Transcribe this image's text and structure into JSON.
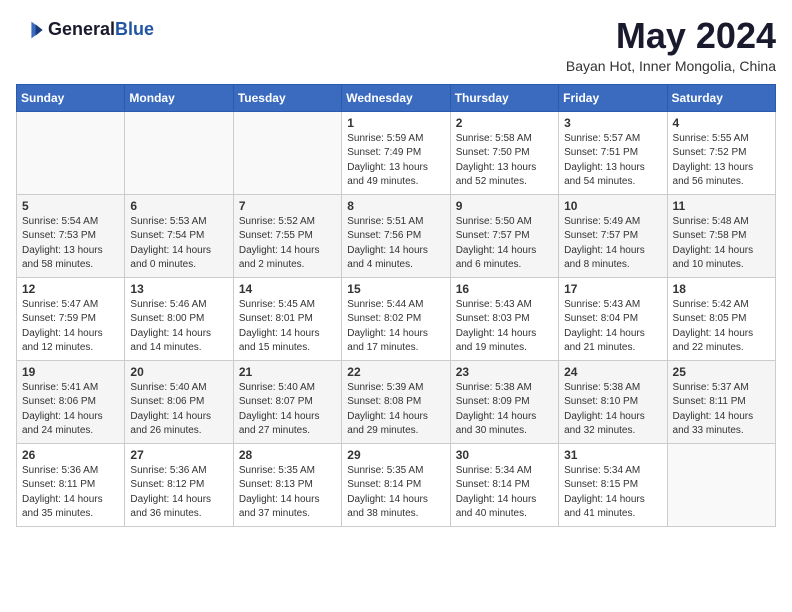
{
  "header": {
    "logo_general": "General",
    "logo_blue": "Blue",
    "title": "May 2024",
    "subtitle": "Bayan Hot, Inner Mongolia, China"
  },
  "days_of_week": [
    "Sunday",
    "Monday",
    "Tuesday",
    "Wednesday",
    "Thursday",
    "Friday",
    "Saturday"
  ],
  "weeks": [
    [
      {
        "day": "",
        "info": ""
      },
      {
        "day": "",
        "info": ""
      },
      {
        "day": "",
        "info": ""
      },
      {
        "day": "1",
        "info": "Sunrise: 5:59 AM\nSunset: 7:49 PM\nDaylight: 13 hours and 49 minutes."
      },
      {
        "day": "2",
        "info": "Sunrise: 5:58 AM\nSunset: 7:50 PM\nDaylight: 13 hours and 52 minutes."
      },
      {
        "day": "3",
        "info": "Sunrise: 5:57 AM\nSunset: 7:51 PM\nDaylight: 13 hours and 54 minutes."
      },
      {
        "day": "4",
        "info": "Sunrise: 5:55 AM\nSunset: 7:52 PM\nDaylight: 13 hours and 56 minutes."
      }
    ],
    [
      {
        "day": "5",
        "info": "Sunrise: 5:54 AM\nSunset: 7:53 PM\nDaylight: 13 hours and 58 minutes."
      },
      {
        "day": "6",
        "info": "Sunrise: 5:53 AM\nSunset: 7:54 PM\nDaylight: 14 hours and 0 minutes."
      },
      {
        "day": "7",
        "info": "Sunrise: 5:52 AM\nSunset: 7:55 PM\nDaylight: 14 hours and 2 minutes."
      },
      {
        "day": "8",
        "info": "Sunrise: 5:51 AM\nSunset: 7:56 PM\nDaylight: 14 hours and 4 minutes."
      },
      {
        "day": "9",
        "info": "Sunrise: 5:50 AM\nSunset: 7:57 PM\nDaylight: 14 hours and 6 minutes."
      },
      {
        "day": "10",
        "info": "Sunrise: 5:49 AM\nSunset: 7:57 PM\nDaylight: 14 hours and 8 minutes."
      },
      {
        "day": "11",
        "info": "Sunrise: 5:48 AM\nSunset: 7:58 PM\nDaylight: 14 hours and 10 minutes."
      }
    ],
    [
      {
        "day": "12",
        "info": "Sunrise: 5:47 AM\nSunset: 7:59 PM\nDaylight: 14 hours and 12 minutes."
      },
      {
        "day": "13",
        "info": "Sunrise: 5:46 AM\nSunset: 8:00 PM\nDaylight: 14 hours and 14 minutes."
      },
      {
        "day": "14",
        "info": "Sunrise: 5:45 AM\nSunset: 8:01 PM\nDaylight: 14 hours and 15 minutes."
      },
      {
        "day": "15",
        "info": "Sunrise: 5:44 AM\nSunset: 8:02 PM\nDaylight: 14 hours and 17 minutes."
      },
      {
        "day": "16",
        "info": "Sunrise: 5:43 AM\nSunset: 8:03 PM\nDaylight: 14 hours and 19 minutes."
      },
      {
        "day": "17",
        "info": "Sunrise: 5:43 AM\nSunset: 8:04 PM\nDaylight: 14 hours and 21 minutes."
      },
      {
        "day": "18",
        "info": "Sunrise: 5:42 AM\nSunset: 8:05 PM\nDaylight: 14 hours and 22 minutes."
      }
    ],
    [
      {
        "day": "19",
        "info": "Sunrise: 5:41 AM\nSunset: 8:06 PM\nDaylight: 14 hours and 24 minutes."
      },
      {
        "day": "20",
        "info": "Sunrise: 5:40 AM\nSunset: 8:06 PM\nDaylight: 14 hours and 26 minutes."
      },
      {
        "day": "21",
        "info": "Sunrise: 5:40 AM\nSunset: 8:07 PM\nDaylight: 14 hours and 27 minutes."
      },
      {
        "day": "22",
        "info": "Sunrise: 5:39 AM\nSunset: 8:08 PM\nDaylight: 14 hours and 29 minutes."
      },
      {
        "day": "23",
        "info": "Sunrise: 5:38 AM\nSunset: 8:09 PM\nDaylight: 14 hours and 30 minutes."
      },
      {
        "day": "24",
        "info": "Sunrise: 5:38 AM\nSunset: 8:10 PM\nDaylight: 14 hours and 32 minutes."
      },
      {
        "day": "25",
        "info": "Sunrise: 5:37 AM\nSunset: 8:11 PM\nDaylight: 14 hours and 33 minutes."
      }
    ],
    [
      {
        "day": "26",
        "info": "Sunrise: 5:36 AM\nSunset: 8:11 PM\nDaylight: 14 hours and 35 minutes."
      },
      {
        "day": "27",
        "info": "Sunrise: 5:36 AM\nSunset: 8:12 PM\nDaylight: 14 hours and 36 minutes."
      },
      {
        "day": "28",
        "info": "Sunrise: 5:35 AM\nSunset: 8:13 PM\nDaylight: 14 hours and 37 minutes."
      },
      {
        "day": "29",
        "info": "Sunrise: 5:35 AM\nSunset: 8:14 PM\nDaylight: 14 hours and 38 minutes."
      },
      {
        "day": "30",
        "info": "Sunrise: 5:34 AM\nSunset: 8:14 PM\nDaylight: 14 hours and 40 minutes."
      },
      {
        "day": "31",
        "info": "Sunrise: 5:34 AM\nSunset: 8:15 PM\nDaylight: 14 hours and 41 minutes."
      },
      {
        "day": "",
        "info": ""
      }
    ]
  ]
}
